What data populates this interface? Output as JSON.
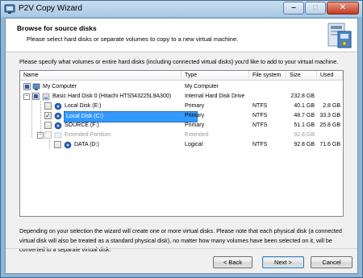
{
  "window": {
    "title": "P2V Copy Wizard",
    "minimize_glyph": "–",
    "maximize_glyph": "□",
    "close_glyph": "✕"
  },
  "header": {
    "title": "Browse for source disks",
    "subtitle": "Please select hard disks or separate volumes to copy to a new virtual machine."
  },
  "instructions": "Please specify what volumes or entire hard disks (including connected virtual disks) you'd like to add to your virtual machine.",
  "table": {
    "columns": [
      "Name",
      "Type",
      "File system",
      "Size",
      "Used"
    ],
    "rows": [
      {
        "name": "My Computer",
        "type": "My Computer",
        "fs": "",
        "size": "",
        "used": ""
      },
      {
        "name": "Basic Hard Disk 0 (Hitachi HTS543225L9A300)",
        "type": "Internal Hard Disk Drive",
        "fs": "",
        "size": "232.8 GB",
        "used": ""
      },
      {
        "name": "Local Disk (E:)",
        "type": "Primary",
        "fs": "NTFS",
        "size": "40.1 GB",
        "used": "2.8 GB"
      },
      {
        "name": "Local Disk (C:)",
        "type": "Primary",
        "fs": "NTFS",
        "size": "48.7 GB",
        "used": "33.3 GB"
      },
      {
        "name": "SOURCE (F:)",
        "type": "Primary",
        "fs": "NTFS",
        "size": "51.1 GB",
        "used": "25.8 GB"
      },
      {
        "name": "Extended Partition",
        "type": "Extended",
        "fs": "",
        "size": "92.8 GB",
        "used": ""
      },
      {
        "name": "DATA (D:)",
        "type": "Logical",
        "fs": "NTFS",
        "size": "92.8 GB",
        "used": "71.6 GB"
      }
    ]
  },
  "info": "Depending on your selection the wizard will create one or more virtual disks. Please note that each physical disk (a connected virtual disk will also be treated as a standard physical disk), no matter how many volumes have been selected on it, will be converted to a separate virtual disk.",
  "buttons": {
    "back": "< Back",
    "next": "Next >",
    "cancel": "Cancel"
  }
}
